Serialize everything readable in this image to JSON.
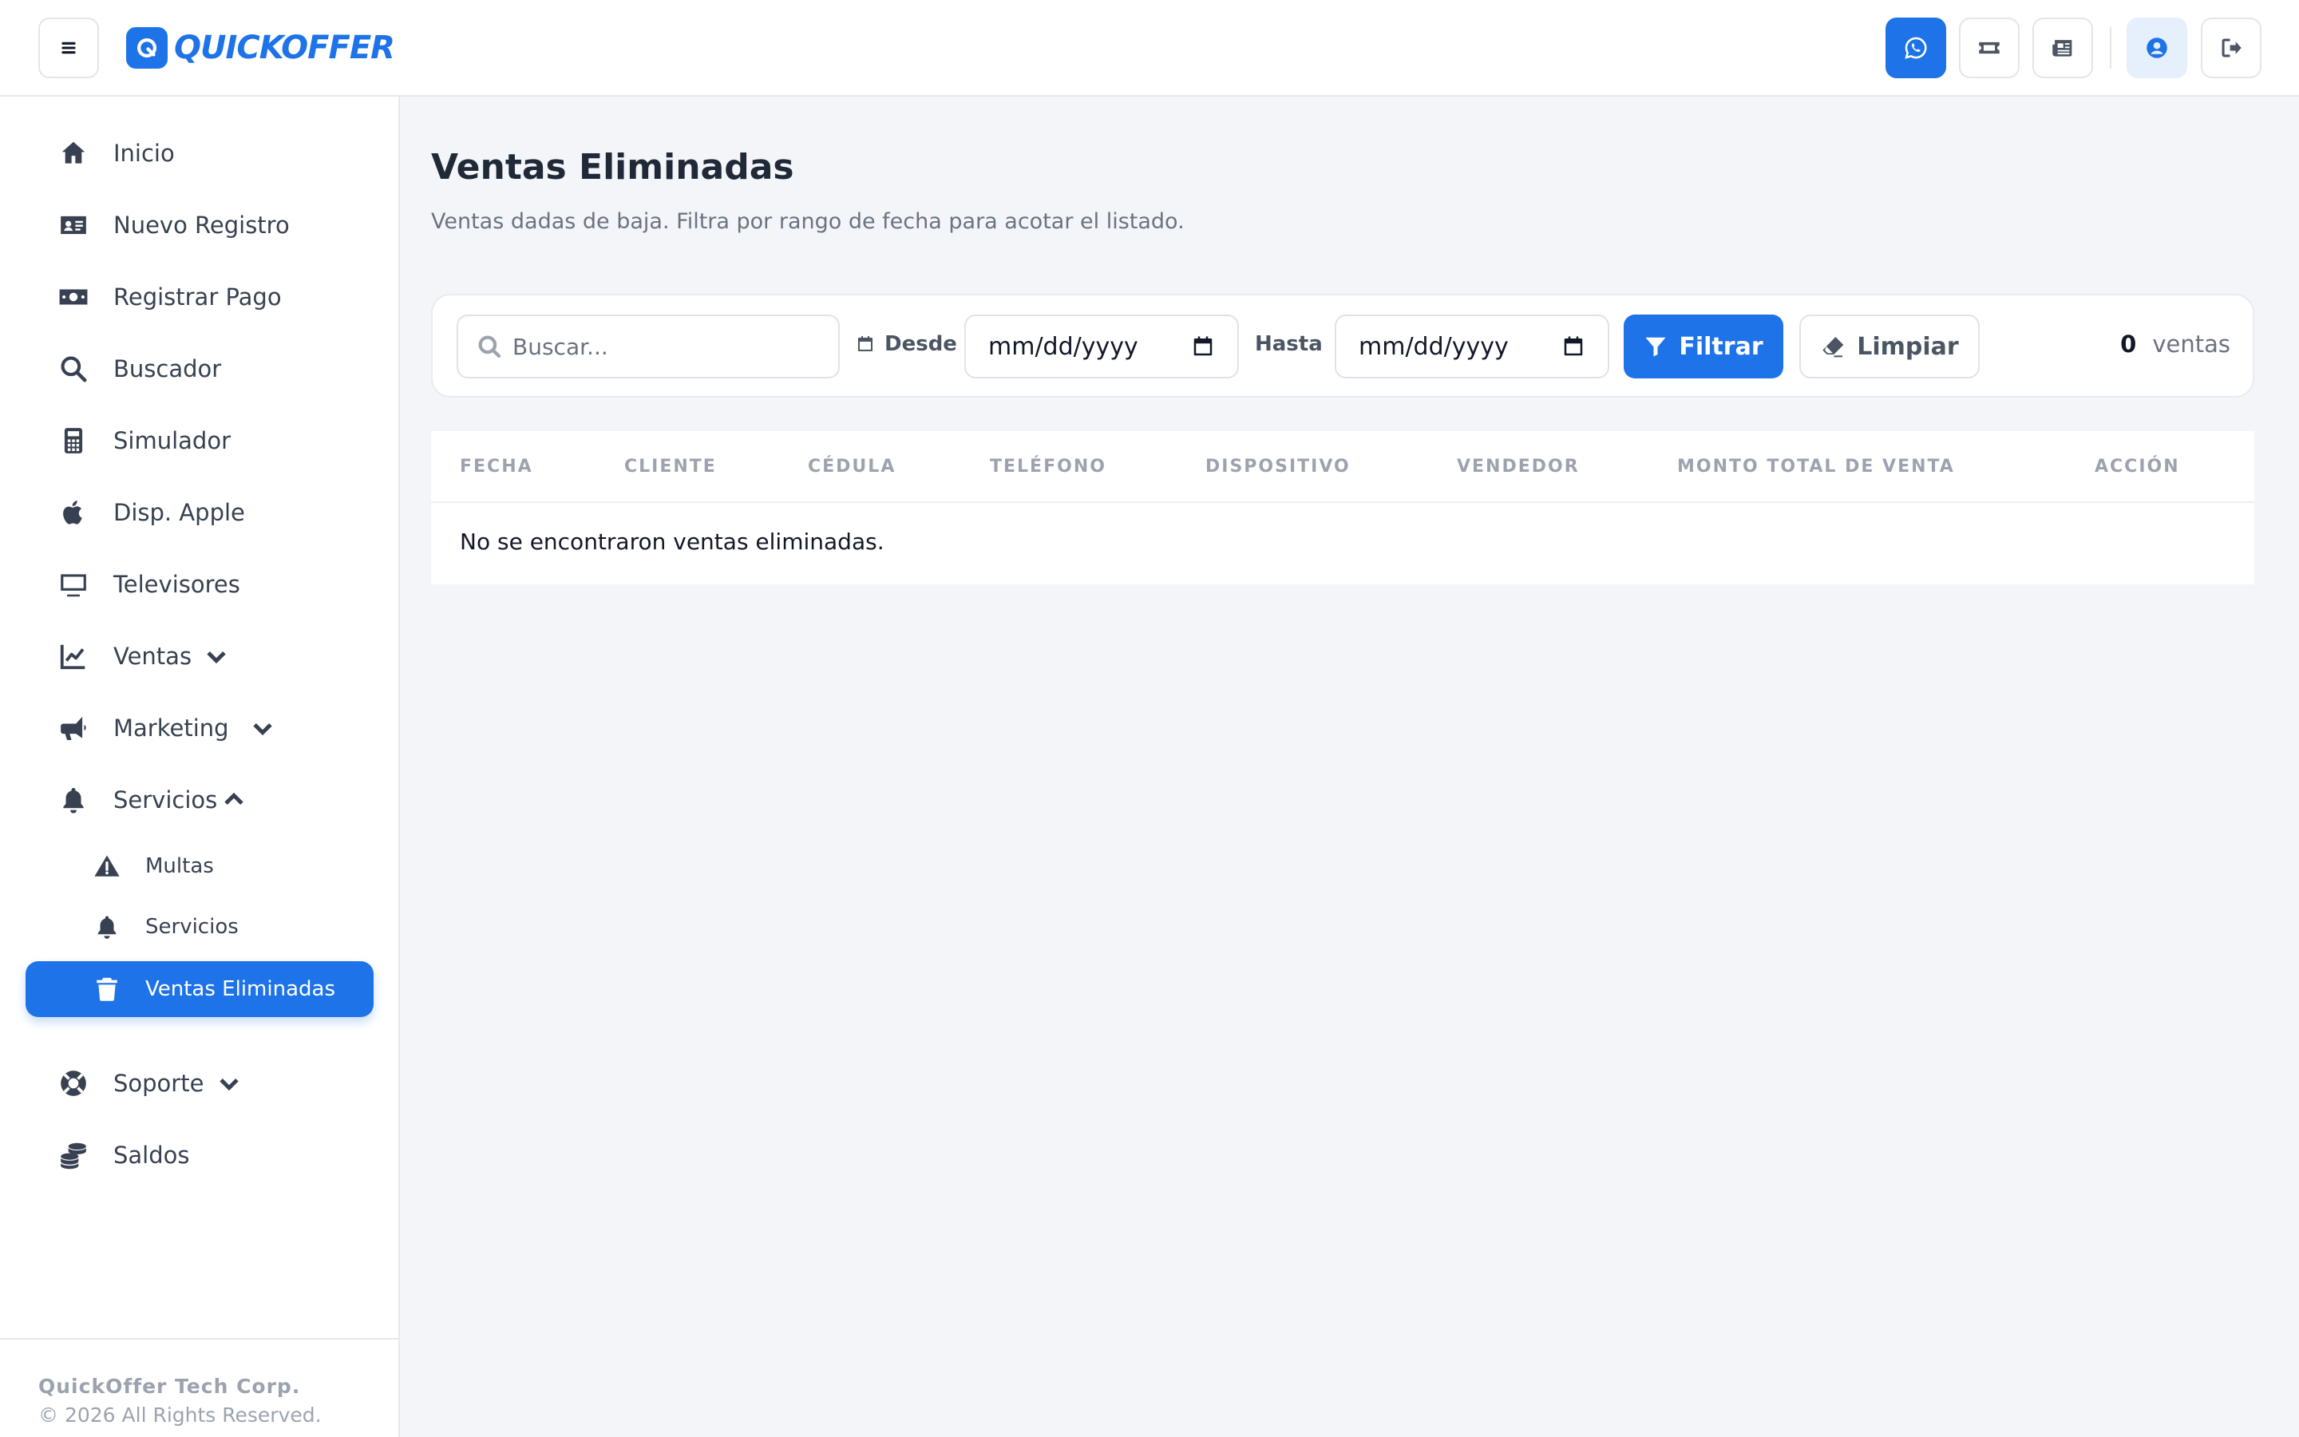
{
  "header": {
    "logo_text": "QUICKOFFER",
    "brand_color": "#1e73e8",
    "icons": [
      "menu-icon",
      "whatsapp-icon",
      "ticket-icon",
      "newspaper-icon",
      "user-circle-icon",
      "logout-icon"
    ]
  },
  "sidebar": {
    "items": [
      {
        "label": "Inicio",
        "icon": "home-icon"
      },
      {
        "label": "Nuevo Registro",
        "icon": "id-card-icon"
      },
      {
        "label": "Registrar Pago",
        "icon": "money-icon"
      },
      {
        "label": "Buscador",
        "icon": "search-icon"
      },
      {
        "label": "Simulador",
        "icon": "calculator-icon"
      },
      {
        "label": "Disp. Apple",
        "icon": "apple-icon"
      },
      {
        "label": "Televisores",
        "icon": "tv-icon"
      },
      {
        "label": "Ventas",
        "icon": "chart-line-icon",
        "expanded": false
      },
      {
        "label": "Marketing",
        "icon": "megaphone-icon",
        "expanded": false
      },
      {
        "label": "Servicios",
        "icon": "bell-icon",
        "expanded": true
      },
      {
        "label": "Soporte",
        "icon": "lifering-icon",
        "expanded": false
      },
      {
        "label": "Saldos",
        "icon": "coins-icon"
      }
    ],
    "sub_items": [
      {
        "label": "Multas",
        "icon": "warning-icon"
      },
      {
        "label": "Servicios",
        "icon": "bell-icon"
      },
      {
        "label": "Ventas Eliminadas",
        "icon": "trash-icon",
        "active": true
      }
    ],
    "footer": {
      "company": "QuickOffer Tech Corp.",
      "copyright": "© 2026 All Rights Reserved."
    }
  },
  "main": {
    "title": "Ventas Eliminadas",
    "subtitle": "Ventas dadas de baja. Filtra por rango de fecha para acotar el listado.",
    "filters": {
      "search_placeholder": "Buscar...",
      "desde_label": "Desde",
      "hasta_label": "Hasta",
      "date_placeholder": "mm/dd/yyyy",
      "filter_button": "Filtrar",
      "clear_button": "Limpiar",
      "count_value": "0",
      "count_label": "ventas"
    },
    "table": {
      "columns": [
        "FECHA",
        "CLIENTE",
        "CÉDULA",
        "TELÉFONO",
        "DISPOSITIVO",
        "VENDEDOR",
        "MONTO TOTAL DE VENTA",
        "ACCIÓN"
      ],
      "rows": [],
      "empty_message": "No se encontraron ventas eliminadas."
    }
  }
}
